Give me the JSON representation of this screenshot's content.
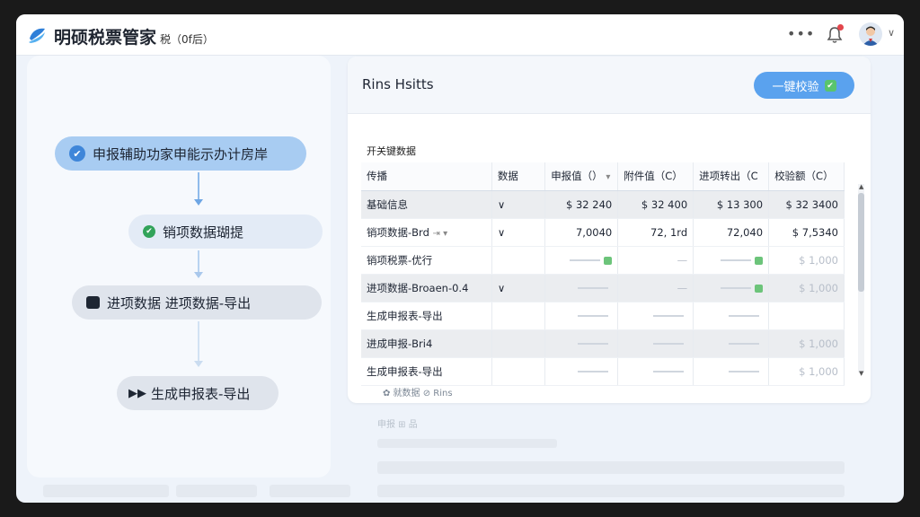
{
  "header": {
    "app_title": "明硕税票管家",
    "app_subtitle": "税（0f后）",
    "bell_badge": true
  },
  "workflow": {
    "steps": [
      {
        "label": "申报辅助功家申能示办计房岸",
        "icon": "check-circle-icon"
      },
      {
        "label": "销项数据瑚提",
        "icon": "check-dot-icon"
      },
      {
        "label": "进项数据 进项数据-导出",
        "icon": "folder-icon"
      },
      {
        "label": "生成申报表-导出",
        "icon": "forward-icon"
      }
    ]
  },
  "panel": {
    "title": "Rins Hsitts",
    "button_label": "一键校验",
    "section_label": "开关键数据",
    "columns": [
      "传播",
      "数据",
      "申报值（）",
      "附件值（C）",
      "进项转出（C",
      "校验额（C）"
    ],
    "rows": [
      {
        "name": "基础信息",
        "status": "∨",
        "c1": "$ 32 240",
        "c2": "$ 32 400",
        "c3": "$ 13 300",
        "c4": "$ 32 3400",
        "shaded": true
      },
      {
        "name": "销项数据-Brd",
        "status": "∨",
        "c1": "7,0040",
        "c2": "72, 1rd",
        "c3": "72,040",
        "c4": "$ 7,5340",
        "shaded": false
      },
      {
        "name": "销项税票-优行",
        "status": "",
        "c1": "",
        "c2": "",
        "c3": "",
        "c4": "$ 1,000",
        "shaded": false
      },
      {
        "name": "进项数据-Broaen-0.4",
        "status": "∨",
        "c1": "",
        "c2": "",
        "c3": "",
        "c4": "$ 1,000",
        "shaded": true
      },
      {
        "name": "生成申报表-导出",
        "status": "",
        "c1": "",
        "c2": "",
        "c3": "",
        "c4": "",
        "shaded": false
      },
      {
        "name": "进成申报-Bri4",
        "status": "",
        "c1": "",
        "c2": "",
        "c3": "",
        "c4": "$ 1,000",
        "shaded": true
      },
      {
        "name": "生成申报表-导出",
        "status": "",
        "c1": "",
        "c2": "",
        "c3": "",
        "c4": "$ 1,000",
        "shaded": false
      }
    ],
    "footer_note": "✿ 就数据    ⊘ Rins"
  },
  "background": {
    "ghost_label": "申报  ⊞ 品"
  }
}
